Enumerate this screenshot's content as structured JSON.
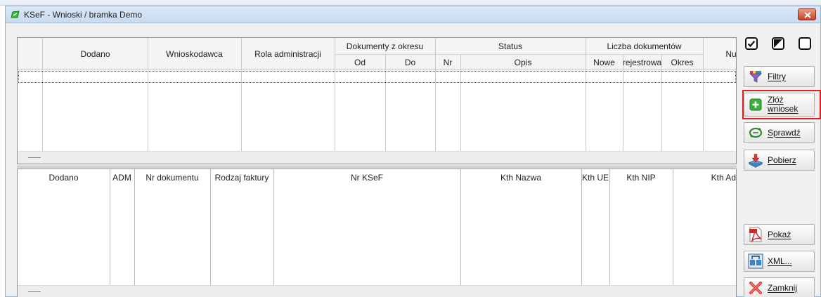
{
  "window": {
    "title": "KSeF - Wnioski / bramka Demo"
  },
  "requests_table": {
    "headers": {
      "dodano": "Dodano",
      "wnioskodawca": "Wnioskodawca",
      "rola": "Rola administracji",
      "dokumenty_group": "Dokumenty z okresu",
      "od": "Od",
      "do": "Do",
      "status_group": "Status",
      "nr": "Nr",
      "opis": "Opis",
      "liczba_group": "Liczba dokumentów",
      "nowe": "Nowe",
      "rejestrowa": "rejestrowa",
      "okres": "Okres",
      "nu": "Nu"
    },
    "rows": []
  },
  "documents_table": {
    "headers": {
      "dodano": "Dodano",
      "adm": "ADM",
      "nr_dokumentu": "Nr dokumentu",
      "rodzaj_faktury": "Rodzaj faktury",
      "nr_ksef": "Nr KSeF",
      "kth_nazwa": "Kth Nazwa",
      "kth_ue": "Kth UE",
      "kth_nip": "Kth NIP",
      "kth_ad": "Kth Ad"
    },
    "rows": []
  },
  "side_panel": {
    "filtry": "Filtry",
    "zloz_line1": "Złóż",
    "zloz_line2": "wniosek",
    "sprawdz": "Sprawdź",
    "pobierz": "Pobierz",
    "pokaz": "Pokaż",
    "xml": "XML...",
    "zamknij": "Zamknij"
  },
  "icons": {
    "app": "app-icon",
    "check_all": "check-all-icon",
    "check_partial": "check-partial-icon",
    "check_none": "check-none-icon",
    "filter": "filter-icon",
    "add": "add-icon",
    "refresh": "refresh-icon",
    "download": "download-icon",
    "pdf": "pdf-icon",
    "xml": "xml-icon",
    "close": "close-icon"
  },
  "colors": {
    "highlight": "#e02020",
    "close_button": "#c6432a"
  }
}
